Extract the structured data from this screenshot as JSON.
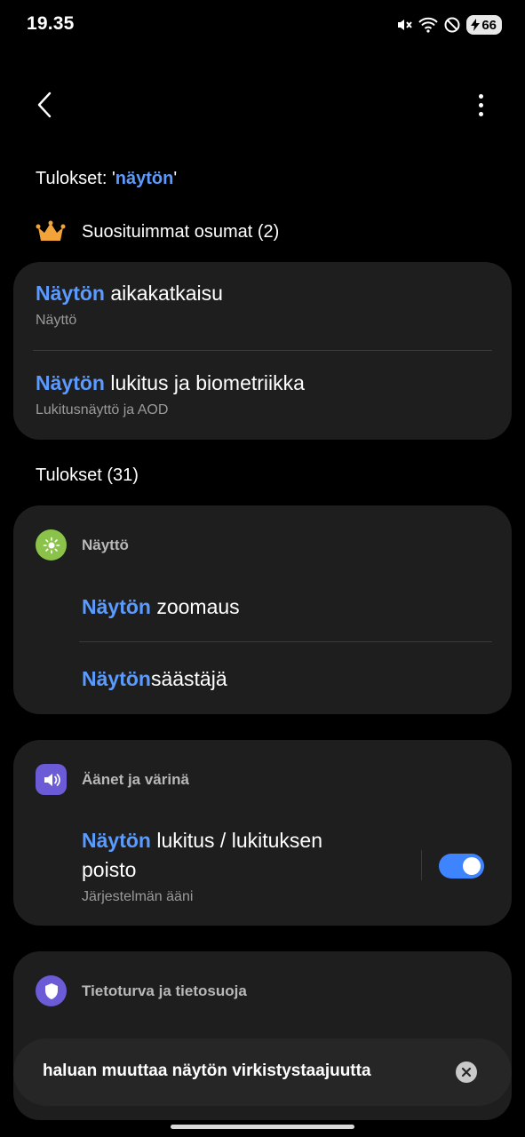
{
  "status_bar": {
    "time": "19.35",
    "battery": "66"
  },
  "results_header": {
    "prefix": "Tulokset: '",
    "query": "näytön",
    "suffix": "'"
  },
  "top_matches": {
    "label": "Suosituimmat osumat (2)",
    "items": [
      {
        "highlight": "Näytön",
        "rest": " aikakatkaisu",
        "sub": "Näyttö"
      },
      {
        "highlight": "Näytön",
        "rest": " lukitus ja biometriikka",
        "sub": "Lukitusnäyttö ja AOD"
      }
    ]
  },
  "results": {
    "label": "Tulokset (31)",
    "groups": [
      {
        "category": "Näyttö",
        "items": [
          {
            "highlight": "Näytön",
            "rest": " zoomaus"
          },
          {
            "highlight": "Näytön",
            "rest": "säästäjä"
          }
        ]
      },
      {
        "category": "Äänet ja värinä",
        "items": [
          {
            "highlight": "Näytön",
            "rest": " lukitus / lukituksen",
            "rest2": "poisto",
            "sub": "Järjestelmän ääni",
            "toggle_on": true
          }
        ]
      },
      {
        "category": "Tietoturva ja tietosuoja"
      }
    ]
  },
  "search": {
    "value": "haluan muuttaa näytön virkistystaajuutta"
  },
  "colors": {
    "highlight": "#5b9bff",
    "card": "#1e1e1e",
    "toggle": "#3f84ff",
    "display_icon": "#8bc34a",
    "sound_icon": "#6b5bd6",
    "security_icon": "#6b5bd6"
  }
}
